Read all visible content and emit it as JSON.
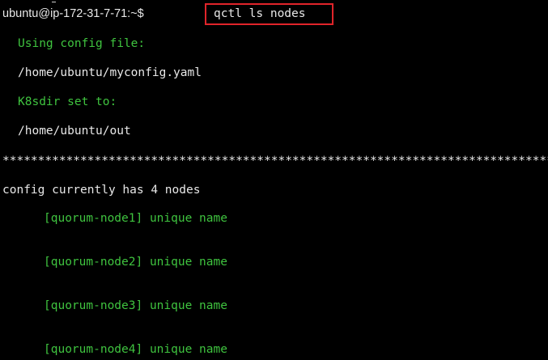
{
  "terminal": {
    "prompt": "ubuntu@ip-172-31-7-71:~$",
    "command": "qctl ls nodes",
    "lines": {
      "config_label": "Using config file:",
      "config_path": "/home/ubuntu/myconfig.yaml",
      "k8sdir_label": "K8sdir set to:",
      "k8sdir_path": "/home/ubuntu/out",
      "separator": "**************************************************************************************************************",
      "summary": "config currently has 4 nodes"
    },
    "nodes": [
      "[quorum-node1] unique name",
      "[quorum-node2] unique name",
      "[quorum-node3] unique name",
      "[quorum-node4] unique name"
    ],
    "colors": {
      "background": "#000000",
      "green_text": "#3fc33f",
      "white_text": "#e8e8e8",
      "highlight_box": "#e0242a"
    }
  }
}
